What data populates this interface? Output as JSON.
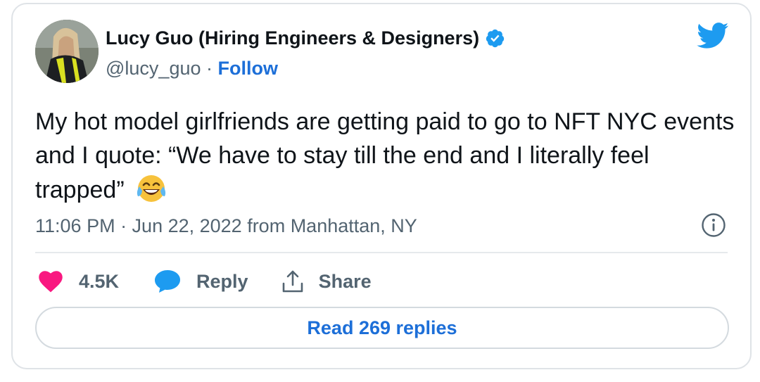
{
  "author": {
    "display_name": "Lucy Guo (Hiring Engineers & Designers)",
    "handle": "@lucy_guo",
    "separator": " · ",
    "follow_label": "Follow",
    "verified": true
  },
  "tweet": {
    "text": "My hot model girlfriends are getting paid to go to NFT NYC events and I quote: “We have to stay till the end and I literally feel trapped”",
    "emoji": "face-with-tears-of-joy",
    "timestamp": "11:06 PM · Jun 22, 2022 from Manhattan, NY"
  },
  "actions": {
    "like_count": "4.5K",
    "reply_label": "Reply",
    "share_label": "Share"
  },
  "read_replies_label": "Read 269 replies",
  "icons": {
    "brand": "twitter-bird-icon",
    "verified": "verified-badge-icon",
    "info": "info-icon",
    "like": "heart-icon",
    "reply": "speech-bubble-icon",
    "share": "share-icon"
  },
  "colors": {
    "twitter_blue": "#1d9bf0",
    "link_blue": "#1d6fd8",
    "like_pink": "#f91880",
    "text_primary": "#0f1419",
    "text_secondary": "#536471"
  }
}
